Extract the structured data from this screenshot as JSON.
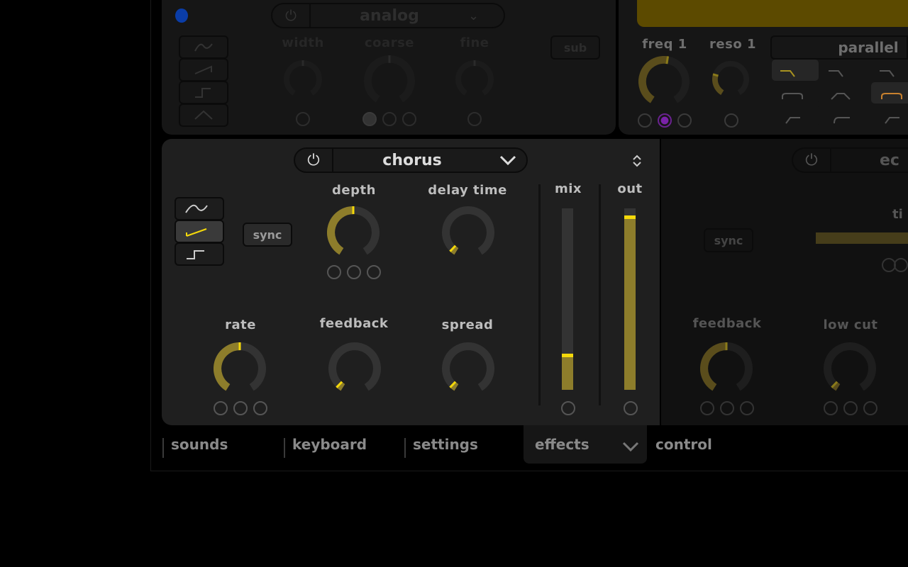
{
  "colors": {
    "accent": "#f5d90a",
    "accent_fill": "#8d7d2b",
    "mod_active": "#8a2bb0",
    "oscillator_dot": "#0a3da8",
    "filter_active": "#c8812e"
  },
  "oscillator": {
    "preset": "analog",
    "power": "on",
    "knobs": [
      {
        "label": "width",
        "value": 0.5
      },
      {
        "label": "coarse",
        "value": 0.5
      },
      {
        "label": "fine",
        "value": 0.5
      }
    ],
    "sub_label": "sub",
    "waveforms": [
      "sine-wave-icon",
      "saw-wave-icon",
      "square-wave-icon",
      "triangle-wave-icon"
    ]
  },
  "filter": {
    "knobs": [
      {
        "label": "freq 1",
        "value": 0.53
      },
      {
        "label": "reso 1",
        "value": 0.25
      }
    ],
    "mode": "parallel",
    "selected_filters": [
      "lowpass-1",
      "bandpass-right"
    ]
  },
  "chorus": {
    "preset": "chorus",
    "power": "on",
    "sync_label": "sync",
    "selected_waveform": "saw-wave-icon",
    "knobs": [
      {
        "label": "depth",
        "value": 0.5
      },
      {
        "label": "delay time",
        "value": 0.04
      },
      {
        "label": "rate",
        "value": 0.5
      },
      {
        "label": "feedback",
        "value": 0.04
      },
      {
        "label": "spread",
        "value": 0.04
      }
    ],
    "mix": {
      "label": "mix",
      "value": 0.2
    },
    "out": {
      "label": "out",
      "value": 0.96
    }
  },
  "echo": {
    "preset": "ec",
    "sync_label": "sync",
    "time_label": "ti",
    "knobs": [
      {
        "label": "feedback",
        "value": 0.5
      },
      {
        "label": "low cut",
        "value": 0.04
      }
    ]
  },
  "tabs": [
    {
      "label": "sounds"
    },
    {
      "label": "keyboard"
    },
    {
      "label": "settings"
    },
    {
      "label": "effects",
      "active": true
    },
    {
      "label": "control"
    }
  ]
}
